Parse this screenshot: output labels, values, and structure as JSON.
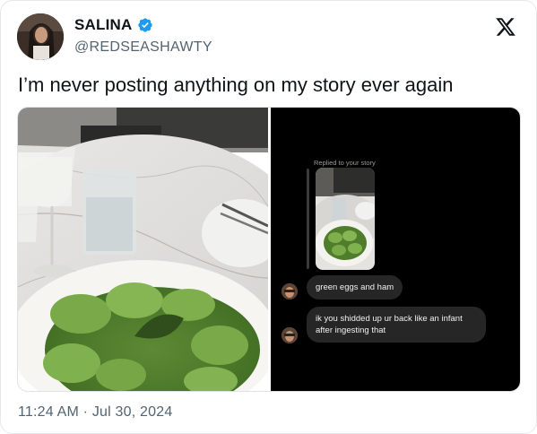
{
  "author": {
    "name": "SALINA",
    "handle": "@REDSEASHAWTY",
    "verified": true
  },
  "tweet": {
    "text": "I’m never posting anything on my story ever again",
    "timestamp": "11:24 AM · Jul 30, 2024"
  },
  "icons": {
    "verified": "verified-badge-icon",
    "brand": "x-logo-icon"
  },
  "story_screenshot": {
    "replied_label": "Replied to your story",
    "messages": [
      {
        "text": "green eggs and ham"
      },
      {
        "text_line1": "ik you shidded up ur back like an infant",
        "text_line2": "after ingesting that"
      }
    ]
  },
  "colors": {
    "verified_blue": "#1d9bf0",
    "handle_gray": "#536471",
    "bubble_bg": "#262626"
  }
}
